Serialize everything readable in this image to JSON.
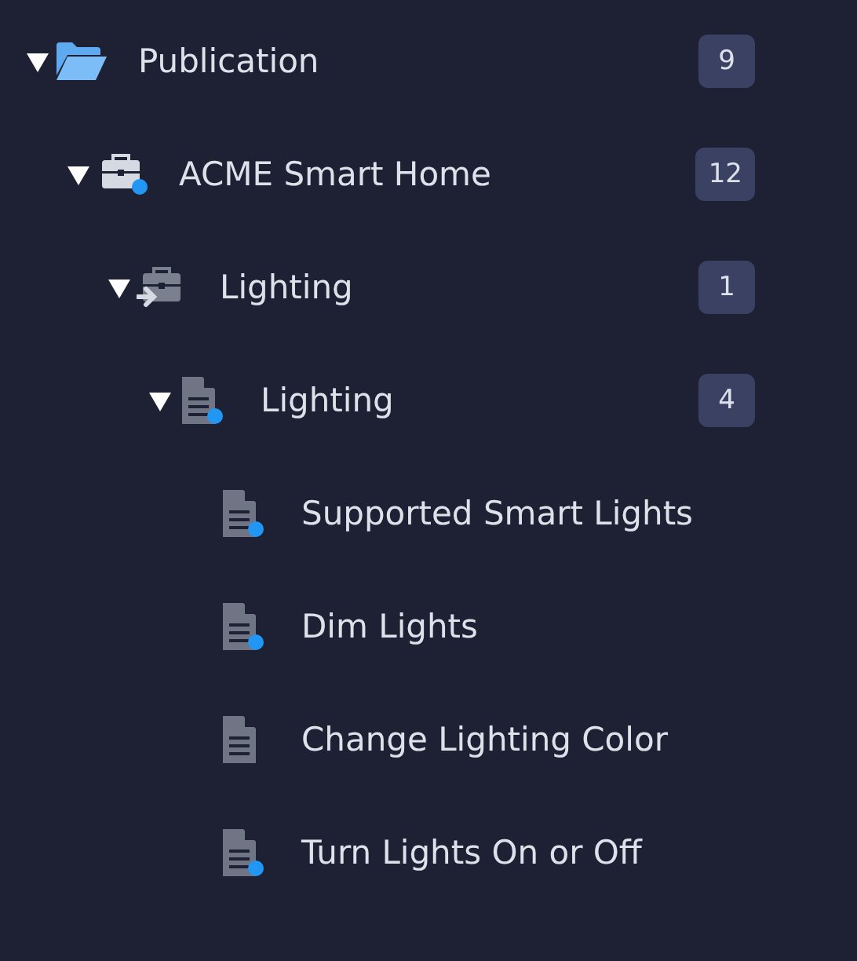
{
  "tree": [
    {
      "kind": "folder",
      "label": "Publication",
      "badge": "9",
      "expanded": true,
      "children": [
        {
          "kind": "product",
          "label": "ACME Smart Home",
          "badge": "12",
          "expanded": true,
          "modified": true,
          "children": [
            {
              "kind": "reference",
              "label": "Lighting",
              "badge": "1",
              "expanded": true,
              "children": [
                {
                  "kind": "topic",
                  "label": "Lighting",
                  "badge": "4",
                  "expanded": true,
                  "modified": true,
                  "children": [
                    {
                      "kind": "topic",
                      "label": "Supported Smart Lights",
                      "modified": true
                    },
                    {
                      "kind": "topic",
                      "label": "Dim Lights",
                      "modified": true
                    },
                    {
                      "kind": "topic",
                      "label": "Change Lighting Color",
                      "modified": false
                    },
                    {
                      "kind": "topic",
                      "label": "Turn Lights On or Off",
                      "modified": true
                    }
                  ]
                }
              ]
            }
          ]
        }
      ]
    }
  ]
}
